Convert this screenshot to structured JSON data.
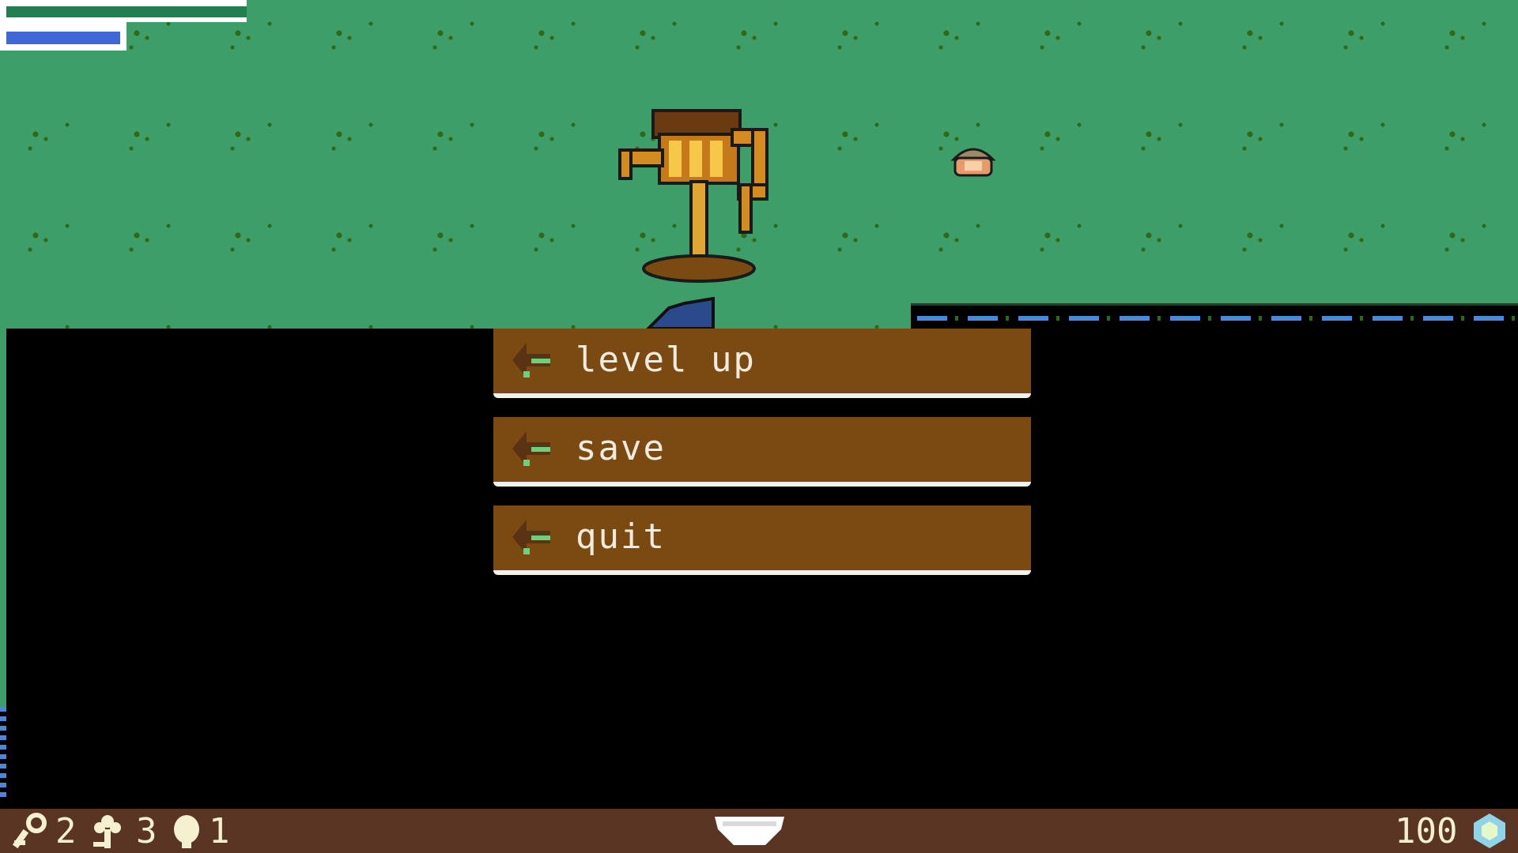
{
  "menu": {
    "items": [
      {
        "label": "level up"
      },
      {
        "label": "save"
      },
      {
        "label": "quit"
      }
    ]
  },
  "hud": {
    "hp_fraction": 1.0,
    "mp_fraction": 1.0,
    "key_count": "2",
    "flower_count": "3",
    "seed_count": "1",
    "gem_count": "100"
  },
  "colors": {
    "grass": "#3e9e6a",
    "menu_bg": "#7a4a12",
    "bottom_bar": "#5a3524",
    "hp": "#237d4f",
    "mp": "#3f67d6"
  }
}
